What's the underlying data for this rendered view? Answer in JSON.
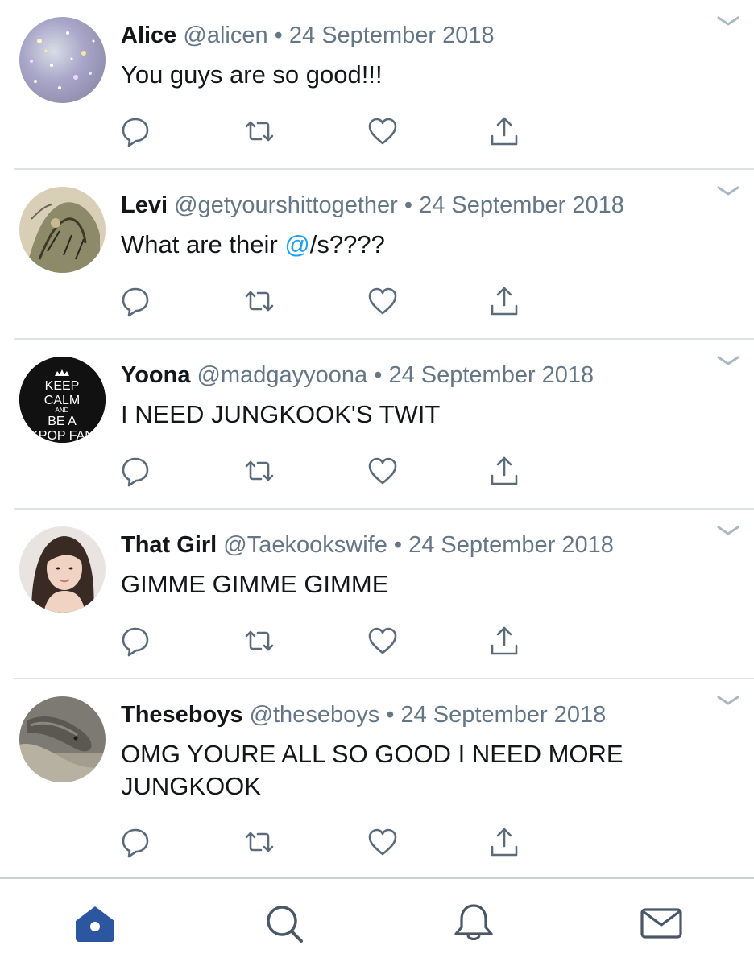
{
  "tweets": [
    {
      "name": "Alice",
      "handle": "@alicen",
      "separator": "•",
      "date": "24 September 2018",
      "text_before": "You guys are so good!!!",
      "mention": "",
      "text_after": "",
      "avatar_icon": "glitter-avatar"
    },
    {
      "name": "Levi",
      "handle": "@getyourshittogether",
      "separator": "•",
      "date": "24 September 2018",
      "text_before": "What are their ",
      "mention": "@",
      "text_after": "/s????",
      "avatar_icon": "sketch-avatar"
    },
    {
      "name": "Yoona",
      "handle": "@madgayyoona",
      "separator": "•",
      "date": "24 September 2018",
      "text_before": "I NEED JUNGKOOK'S TWIT",
      "mention": "",
      "text_after": "",
      "avatar_icon": "keep-calm-avatar",
      "avatar_text": {
        "line1": "KEEP",
        "line2": "CALM",
        "line3": "AND",
        "line4": "BE A",
        "line5": "KPOP FAN"
      }
    },
    {
      "name": "That Girl",
      "handle": "@Taekookswife",
      "separator": "•",
      "date": "24 September 2018",
      "text_before": "GIMME GIMME GIMME",
      "mention": "",
      "text_after": "",
      "avatar_icon": "portrait-avatar"
    },
    {
      "name": "Theseboys",
      "handle": "@theseboys",
      "separator": "•",
      "date": "24 September 2018",
      "text_before": "OMG YOURE ALL SO GOOD I NEED MORE JUNGKOOK",
      "mention": "",
      "text_after": "",
      "avatar_icon": "anteater-avatar"
    }
  ],
  "action_icons": [
    "reply-icon",
    "retweet-icon",
    "like-icon",
    "share-icon"
  ],
  "tabbar": {
    "items": [
      "home-icon",
      "search-icon",
      "notifications-icon",
      "messages-icon"
    ],
    "active": "home-icon"
  },
  "colors": {
    "text": "#14171a",
    "muted": "#657786",
    "accent": "#1da1f2",
    "icon": "#5b6b7a",
    "tab_active": "#2c56a0",
    "tab_icon": "#4a5866",
    "divider": "#dfe3e6"
  }
}
